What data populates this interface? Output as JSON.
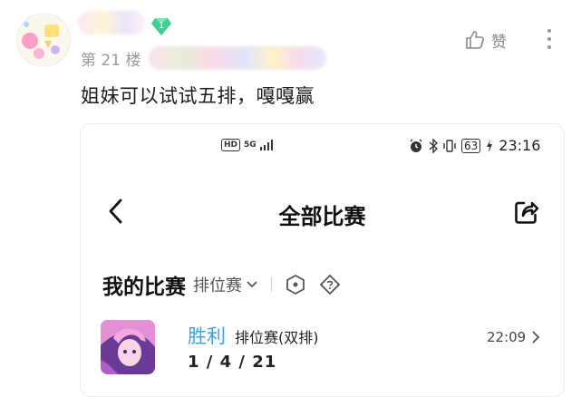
{
  "post": {
    "floor": "第 21 楼",
    "level": "1",
    "like_label": "赞",
    "text": "姐妹可以试试五排，嘎嘎赢"
  },
  "screenshot": {
    "status": {
      "hd": "HD",
      "network": "5G",
      "battery": "63",
      "time": "23:16"
    },
    "nav_title": "全部比赛",
    "section_title": "我的比赛",
    "mode_filter": "排位赛",
    "match": {
      "result": "胜利",
      "mode": "排位赛(双排)",
      "kda": "1 / 4 / 21",
      "time": "22:09"
    }
  },
  "colors": {
    "win_blue": "#3ba3e8",
    "badge_green": "#3fcf8e"
  }
}
